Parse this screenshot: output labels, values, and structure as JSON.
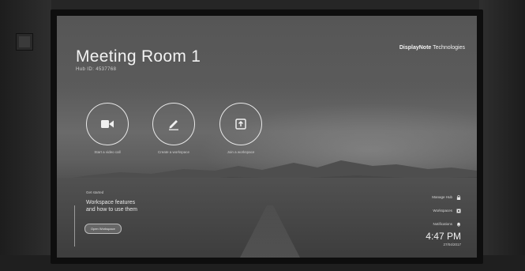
{
  "room": {
    "title": "Meeting Room 1",
    "hub_id": "Hub ID: 4537768"
  },
  "brand": {
    "name_bold": "DisplayNote",
    "name_rest": " Technologies"
  },
  "actions": [
    {
      "label": "Start a video call",
      "icon": "video-camera-icon"
    },
    {
      "label": "Create a workspace",
      "icon": "pen-icon"
    },
    {
      "label": "Join a workspace",
      "icon": "join-arrow-icon"
    }
  ],
  "tip": {
    "kicker": "Get started",
    "title_line1": "Workspace features",
    "title_line2": "and how to use them",
    "button": "Open Workspace"
  },
  "side_menu": [
    {
      "label": "Manage Hub",
      "icon": "lock-icon"
    },
    {
      "label": "Workspaces",
      "icon": "square-icon"
    },
    {
      "label": "Notifications",
      "icon": "bell-icon"
    }
  ],
  "clock": {
    "time": "4:47 PM",
    "date": "27/04/2017"
  }
}
